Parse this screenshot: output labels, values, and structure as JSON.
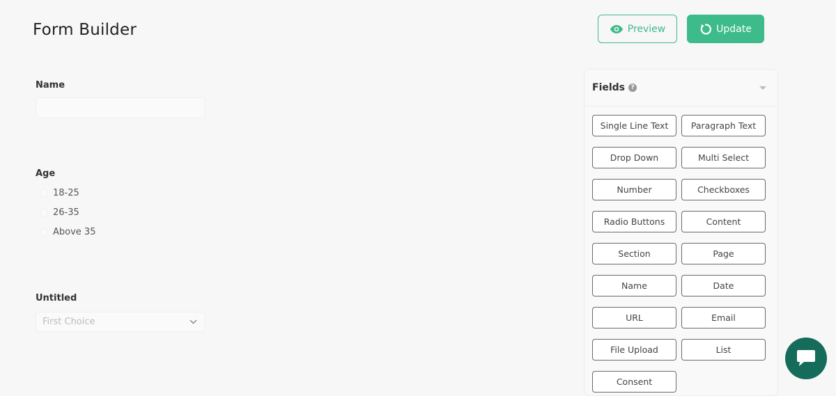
{
  "header": {
    "title": "Form Builder",
    "preview_label": "Preview",
    "update_label": "Update"
  },
  "form": {
    "name_field": {
      "label": "Name",
      "value": ""
    },
    "age_field": {
      "label": "Age",
      "options": [
        "18-25",
        "26-35",
        "Above 35"
      ]
    },
    "untitled_field": {
      "label": "Untitled",
      "selected": "First Choice"
    }
  },
  "fields_panel": {
    "title": "Fields",
    "buttons": [
      "Single Line Text",
      "Paragraph Text",
      "Drop Down",
      "Multi Select",
      "Number",
      "Checkboxes",
      "Radio Buttons",
      "Content",
      "Section",
      "Page",
      "Name",
      "Date",
      "URL",
      "Email",
      "File Upload",
      "List",
      "Consent"
    ]
  },
  "colors": {
    "accent": "#3dbb8a",
    "chat": "#156c5b",
    "background": "#f7f7f7"
  },
  "icons": {
    "preview": "eye-icon",
    "update": "refresh-icon",
    "help": "question-circle-icon",
    "collapse": "caret-down-icon",
    "select": "chevron-down-icon",
    "chat": "chat-icon"
  }
}
